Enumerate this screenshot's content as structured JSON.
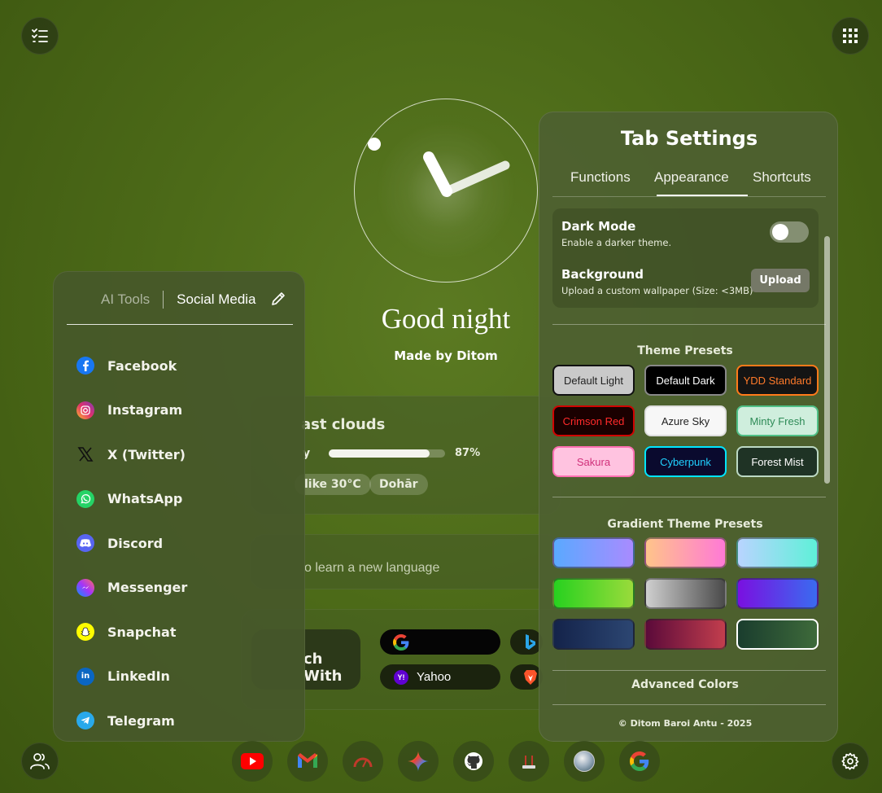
{
  "greeting": "Good night",
  "credit": "Made by Ditom",
  "weather": {
    "condition": "ast clouds",
    "humidity_label": "y",
    "humidity_percent": 87,
    "humidity_text": "87%",
    "feels_like": "like 30°C",
    "location": "Dohār"
  },
  "todo": {
    "placeholder": "o learn a new language"
  },
  "search": {
    "label": "ch With",
    "engines": [
      {
        "name": "Google",
        "label": ""
      },
      {
        "name": "Yahoo",
        "label": "Yahoo"
      },
      {
        "name": "Bing",
        "label": ""
      },
      {
        "name": "Brave",
        "label": ""
      }
    ]
  },
  "shortcuts_panel": {
    "tabs": [
      "AI Tools",
      "Social Media"
    ],
    "active_tab": "Social Media",
    "items": [
      {
        "label": "Facebook",
        "icon": "facebook-icon",
        "color": "#1877f2"
      },
      {
        "label": "Instagram",
        "icon": "instagram-icon",
        "color": "#e1306c"
      },
      {
        "label": "X (Twitter)",
        "icon": "x-icon",
        "color": "#000000"
      },
      {
        "label": "WhatsApp",
        "icon": "whatsapp-icon",
        "color": "#25d366"
      },
      {
        "label": "Discord",
        "icon": "discord-icon",
        "color": "#5865f2"
      },
      {
        "label": "Messenger",
        "icon": "messenger-icon",
        "color": "#a334fa"
      },
      {
        "label": "Snapchat",
        "icon": "snapchat-icon",
        "color": "#fffc00"
      },
      {
        "label": "LinkedIn",
        "icon": "linkedin-icon",
        "color": "#0a66c2"
      },
      {
        "label": "Telegram",
        "icon": "telegram-icon",
        "color": "#29a9eb"
      }
    ]
  },
  "settings": {
    "title": "Tab Settings",
    "tabs": [
      "Functions",
      "Appearance",
      "Shortcuts"
    ],
    "active_tab": "Appearance",
    "dark_mode": {
      "label": "Dark Mode",
      "desc": "Enable a darker theme.",
      "enabled": false
    },
    "background": {
      "label": "Background",
      "desc": "Upload a custom wallpaper (Size: <3MB)",
      "button": "Upload"
    },
    "theme_presets_title": "Theme Presets",
    "theme_presets": [
      {
        "label": "Default Light",
        "bg": "#c9c9c9",
        "fg": "#222222",
        "border": "#111111"
      },
      {
        "label": "Default Dark",
        "bg": "#000000",
        "fg": "#ffffff",
        "border": "#888888"
      },
      {
        "label": "YDD Standard",
        "bg": "#141414",
        "fg": "#ff7a2a",
        "border": "#ff7a1a"
      },
      {
        "label": "Crimson Red",
        "bg": "#1a0000",
        "fg": "#ff2a2a",
        "border": "#d00000"
      },
      {
        "label": "Azure Sky",
        "bg": "#f7f7f7",
        "fg": "#222222",
        "border": "#dddddd"
      },
      {
        "label": "Minty Fresh",
        "bg": "#cfeedd",
        "fg": "#2e8b57",
        "border": "#4fbf86"
      },
      {
        "label": "Sakura",
        "bg": "#ffc3e0",
        "fg": "#d0307a",
        "border": "#ff6fb2"
      },
      {
        "label": "Cyberpunk",
        "bg": "#0a0a2e",
        "fg": "#20d0ff",
        "border": "#00e5ff"
      },
      {
        "label": "Forest Mist",
        "bg": "#1f3325",
        "fg": "#ffffff",
        "border": "#bcd9c4"
      }
    ],
    "gradient_presets_title": "Gradient Theme Presets",
    "gradient_presets": [
      {
        "from": "#5aa9ff",
        "to": "#a98bff"
      },
      {
        "from": "#ffc48a",
        "to": "#ff79d6"
      },
      {
        "from": "#b9d4ff",
        "to": "#5ef0d8"
      },
      {
        "from": "#27d11f",
        "to": "#9adb3b"
      },
      {
        "from": "#cfcfcf",
        "to": "#4a4a4a"
      },
      {
        "from": "#7a10e0",
        "to": "#3a6bf0"
      },
      {
        "from": "#14234a",
        "to": "#2c4672"
      },
      {
        "from": "#5b0a3a",
        "to": "#c23e4d"
      },
      {
        "from": "#1a3d2e",
        "to": "#3e6a3a"
      }
    ],
    "advanced_title": "Advanced Colors",
    "footer": "© Ditom Baroi Antu - 2025"
  },
  "dock": [
    "youtube-icon",
    "gmail-icon",
    "speedtest-icon",
    "gemini-icon",
    "github-icon",
    "router-icon",
    "avatar-icon",
    "google-icon"
  ]
}
